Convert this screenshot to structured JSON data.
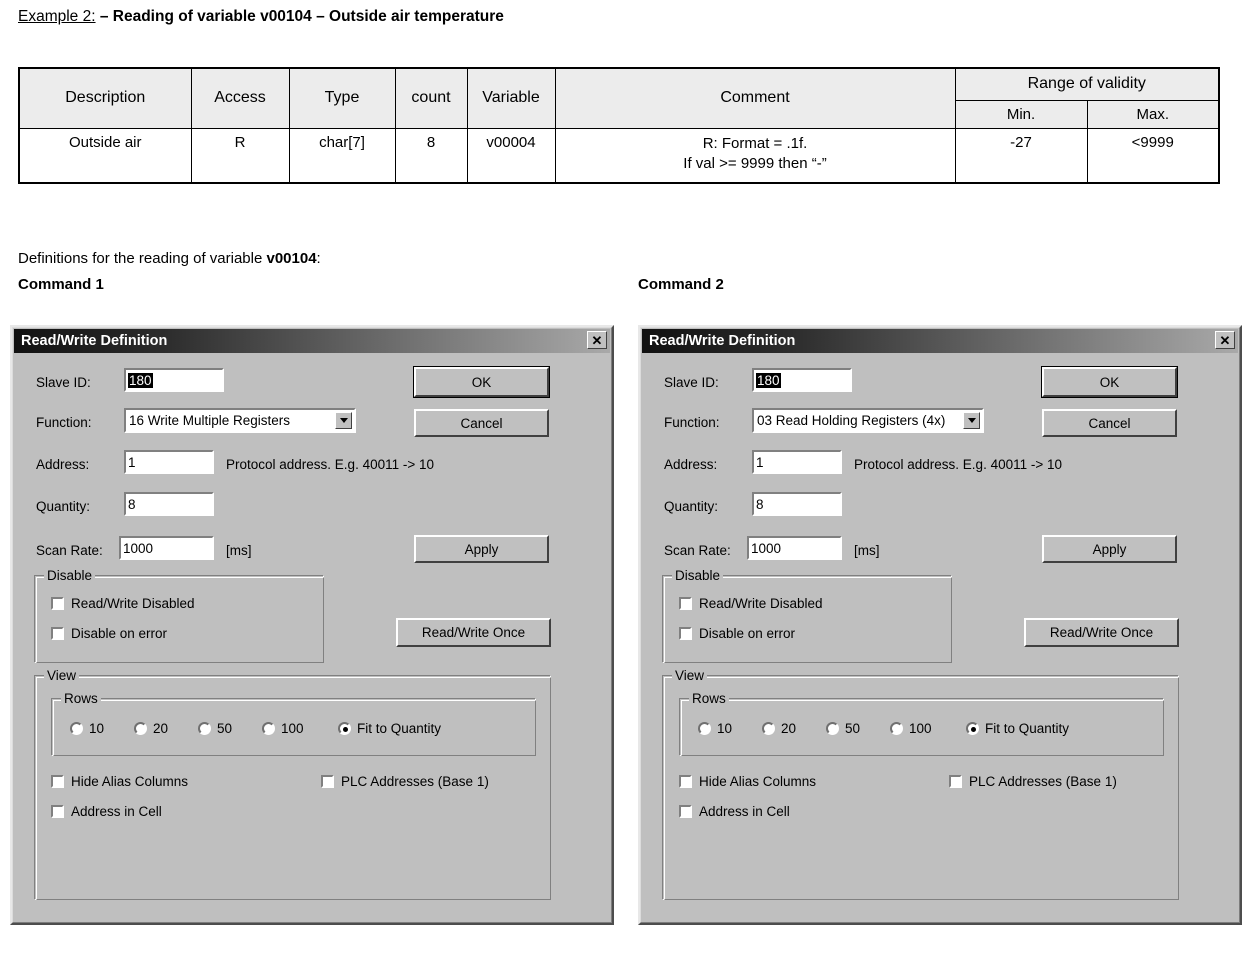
{
  "heading": {
    "example_label": "Example 2:",
    "rest": " – Reading of variable v00104 – Outside air temperature"
  },
  "spec_table": {
    "headers": [
      "Description",
      "Access",
      "Type",
      "count",
      "Variable",
      "Comment",
      "Range of validity"
    ],
    "subheaders": [
      "Min.",
      "Max."
    ],
    "row": {
      "description": "Outside air",
      "access": "R",
      "type": "char[7]",
      "count": "8",
      "variable": "v00004",
      "comment_line1": "R: Format = .1f.",
      "comment_line2": "If val >= 9999 then “-”",
      "min": "-27",
      "max": "<9999"
    }
  },
  "definitions_text": {
    "prefix": "Definitions for the reading of variable ",
    "variable": "v00104",
    "suffix": ":"
  },
  "command_labels": {
    "command1": "Command 1",
    "command2": "Command 2"
  },
  "dialog1": {
    "title": "Read/Write Definition",
    "close_label": "✕",
    "slave_id_label": "Slave ID:",
    "slave_id_value": "180",
    "function_label": "Function:",
    "function_value": "16 Write Multiple Registers",
    "address_label": "Address:",
    "address_value": "1",
    "address_hint": "Protocol address. E.g. 40011 -> 10",
    "quantity_label": "Quantity:",
    "quantity_value": "8",
    "scan_rate_label": "Scan Rate:",
    "scan_rate_value": "1000",
    "scan_rate_unit": "[ms]",
    "ok_label": "OK",
    "cancel_label": "Cancel",
    "apply_label": "Apply",
    "read_write_once_label": "Read/Write Once",
    "disable_group_title": "Disable",
    "disable_checkboxes": [
      {
        "label": "Read/Write Disabled",
        "checked": false
      },
      {
        "label": "Disable on error",
        "checked": false
      }
    ],
    "view_group_title": "View",
    "rows_group_title": "Rows",
    "rows_options": [
      {
        "label": "10",
        "selected": false
      },
      {
        "label": "20",
        "selected": false
      },
      {
        "label": "50",
        "selected": false
      },
      {
        "label": "100",
        "selected": false
      },
      {
        "label": "Fit to Quantity",
        "selected": true
      }
    ],
    "view_checkboxes": [
      {
        "label": "Hide Alias Columns",
        "checked": false
      },
      {
        "label": "PLC Addresses (Base 1)",
        "checked": false
      },
      {
        "label": "Address in Cell",
        "checked": false
      }
    ]
  },
  "dialog2": {
    "title": "Read/Write Definition",
    "close_label": "✕",
    "slave_id_label": "Slave ID:",
    "slave_id_value": "180",
    "function_label": "Function:",
    "function_value": "03 Read Holding Registers (4x)",
    "address_label": "Address:",
    "address_value": "1",
    "address_hint": "Protocol address. E.g. 40011 -> 10",
    "quantity_label": "Quantity:",
    "quantity_value": "8",
    "scan_rate_label": "Scan Rate:",
    "scan_rate_value": "1000",
    "scan_rate_unit": "[ms]",
    "ok_label": "OK",
    "cancel_label": "Cancel",
    "apply_label": "Apply",
    "read_write_once_label": "Read/Write Once",
    "disable_group_title": "Disable",
    "disable_checkboxes": [
      {
        "label": "Read/Write Disabled",
        "checked": false
      },
      {
        "label": "Disable on error",
        "checked": false
      }
    ],
    "view_group_title": "View",
    "rows_group_title": "Rows",
    "rows_options": [
      {
        "label": "10",
        "selected": false
      },
      {
        "label": "20",
        "selected": false
      },
      {
        "label": "50",
        "selected": false
      },
      {
        "label": "100",
        "selected": false
      },
      {
        "label": "Fit to Quantity",
        "selected": true
      }
    ],
    "view_checkboxes": [
      {
        "label": "Hide Alias Columns",
        "checked": false
      },
      {
        "label": "PLC Addresses (Base 1)",
        "checked": false
      },
      {
        "label": "Address in Cell",
        "checked": false
      }
    ]
  }
}
